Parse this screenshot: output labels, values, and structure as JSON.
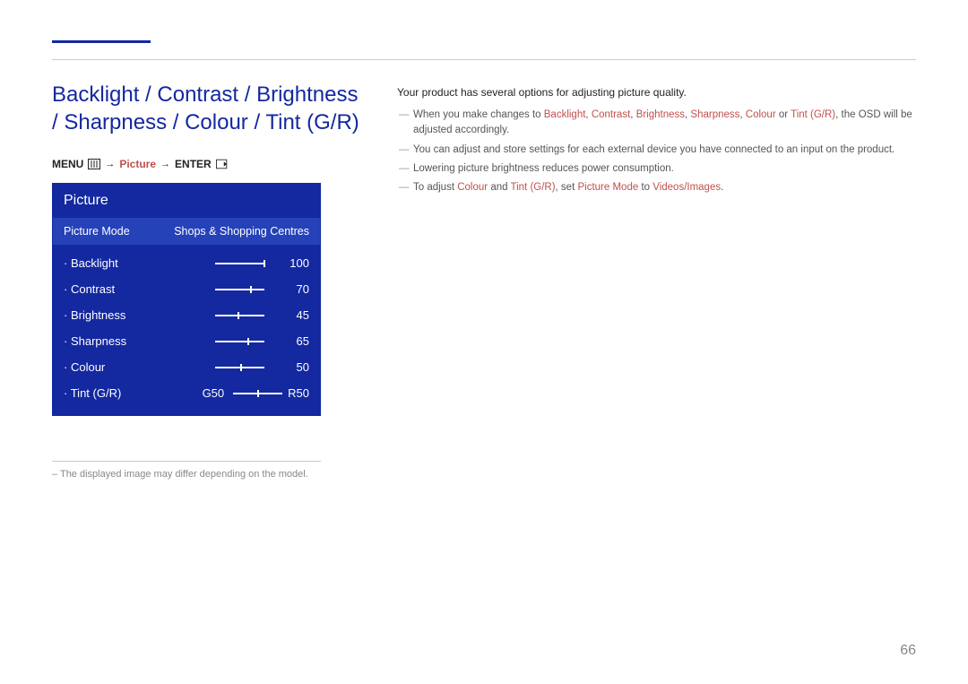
{
  "pageNumber": "66",
  "title": "Backlight / Contrast / Brightness / Sharpness / Colour / Tint (G/R)",
  "navPath": {
    "menu": "MENU",
    "picture": "Picture",
    "enter": "ENTER"
  },
  "osd": {
    "header": "Picture",
    "modeLabel": "Picture Mode",
    "modeValue": "Shops & Shopping Centres",
    "items": [
      {
        "label": "Backlight",
        "value": "100",
        "pos": 100
      },
      {
        "label": "Contrast",
        "value": "70",
        "pos": 70
      },
      {
        "label": "Brightness",
        "value": "45",
        "pos": 45
      },
      {
        "label": "Sharpness",
        "value": "65",
        "pos": 65
      },
      {
        "label": "Colour",
        "value": "50",
        "pos": 50
      }
    ],
    "tint": {
      "label": "Tint (G/R)",
      "g": "G50",
      "r": "R50"
    }
  },
  "footnote": "– The displayed image may differ depending on the model.",
  "intro": "Your product has several options for adjusting picture quality.",
  "bullets": {
    "b1_pre": "When you make changes to ",
    "b1_items": [
      "Backlight",
      "Contrast",
      "Brightness",
      "Sharpness",
      "Colour",
      "Tint (G/R)"
    ],
    "b1_sep_comma": ", ",
    "b1_sep_or": " or ",
    "b1_post": ", the OSD will be adjusted accordingly.",
    "b2": "You can adjust and store settings for each external device you have connected to an input on the product.",
    "b3": "Lowering picture brightness reduces power consumption.",
    "b4_pre": "To adjust ",
    "b4_colour": "Colour",
    "b4_and": " and ",
    "b4_tint": "Tint (G/R)",
    "b4_set": ", set ",
    "b4_pm": "Picture Mode",
    "b4_to": " to ",
    "b4_vi": "Videos/Images",
    "b4_dot": "."
  }
}
